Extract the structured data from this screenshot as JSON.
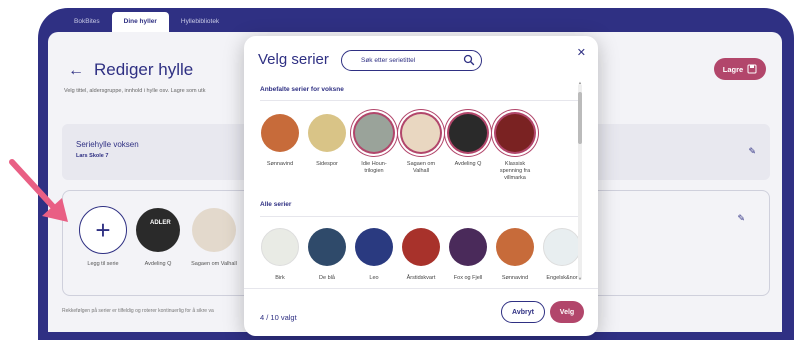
{
  "nav": {
    "tabs": [
      "BokBites",
      "Dine hyller",
      "Hyllebibliotek"
    ]
  },
  "page": {
    "title": "Rediger hylle",
    "subtitle": "Velg tittel, aldersgruppe, innhold i hylle osv. Lagre som utk",
    "save_label": "Lagre"
  },
  "shelf_card": {
    "title": "Seriehylle voksen",
    "school": "Lars Skole 7"
  },
  "shelf_items": {
    "add_label": "Legg til serie",
    "items": [
      {
        "label": "Avdeling Q"
      },
      {
        "label": "Sagaen om Valhall"
      }
    ]
  },
  "footer_note": "Rekkefølgen på serier er tilfeldig og roterer kontinuerlig for å sikre va",
  "modal": {
    "title": "Velg serier",
    "search_placeholder": "Søk etter serietittel",
    "section_recommended": "Anbefalte serier for voksne",
    "section_all": "Alle serier",
    "count": "4 / 10 valgt",
    "cancel_label": "Avbryt",
    "select_label": "Velg",
    "recommended": [
      {
        "label": "Sønnavind",
        "selected": false,
        "color": "#c76b3a"
      },
      {
        "label": "Sidespor",
        "selected": false,
        "color": "#d9c487"
      },
      {
        "label": "Idie Houn-trilogien",
        "selected": true,
        "color": "#9aa39a"
      },
      {
        "label": "Sagaen om Valhall",
        "selected": true,
        "color": "#e9d7c1"
      },
      {
        "label": "Avdeling Q",
        "selected": true,
        "color": "#2a2a2a"
      },
      {
        "label": "Klassisk spenning fra villmarka",
        "selected": true,
        "color": "#7a2222"
      }
    ],
    "all": [
      {
        "label": "Birk",
        "color": "#e9ebe5"
      },
      {
        "label": "De blå",
        "color": "#2f4a6a"
      },
      {
        "label": "Leo",
        "color": "#2a3a80"
      },
      {
        "label": "Årstidskvart",
        "color": "#a8322b"
      },
      {
        "label": "Fox og Fjell",
        "color": "#4a2a5a"
      },
      {
        "label": "Sønnavind",
        "color": "#c76b3a"
      },
      {
        "label": "Engelsk&nor",
        "color": "#e8eef0"
      }
    ]
  },
  "colors": {
    "brand": "#2f3083",
    "accent": "#b2466b",
    "arrow": "#e95f84"
  }
}
